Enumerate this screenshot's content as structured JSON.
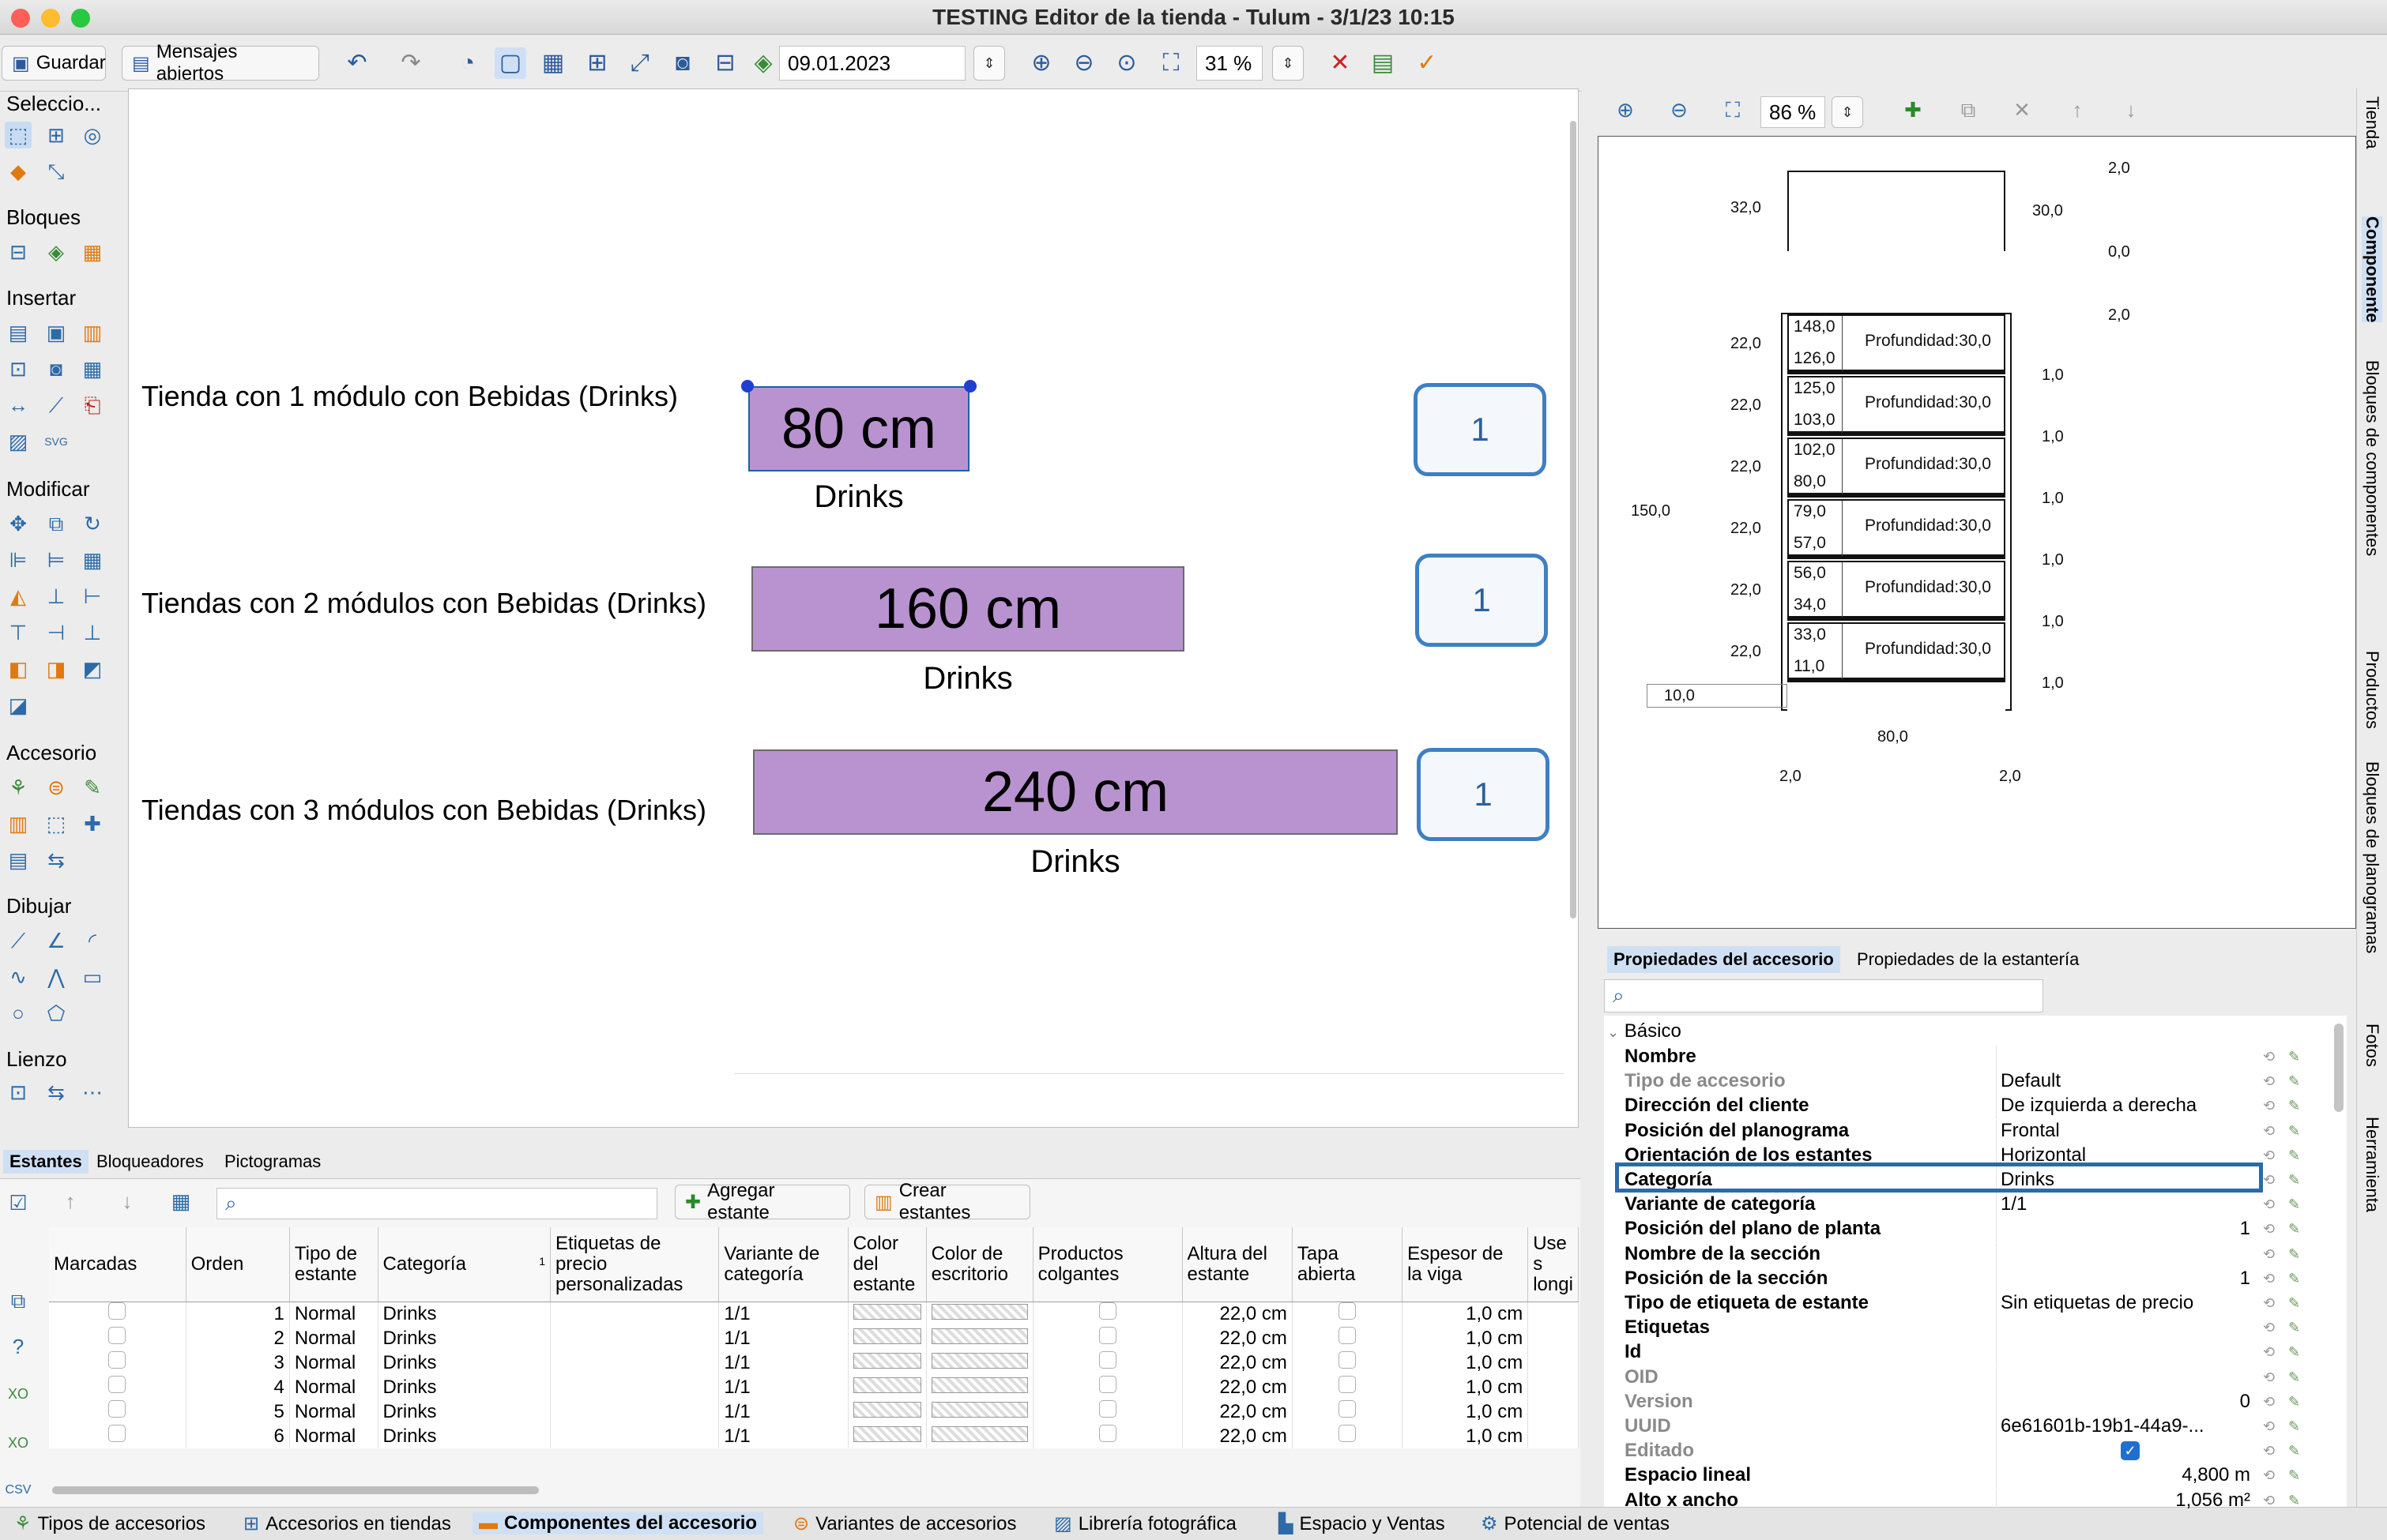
{
  "window": {
    "title": "TESTING Editor de la tienda - Tulum - 3/1/23 10:15"
  },
  "toolbar": {
    "save_label": "Guardar",
    "messages_label": "Mensajes abiertos",
    "date_value": "09.01.2023",
    "zoom_value": "31 %"
  },
  "palette": {
    "select": "Seleccio...",
    "blocks": "Bloques",
    "insert": "Insertar",
    "modify": "Modificar",
    "accessory": "Accesorio",
    "draw": "Dibujar",
    "canvas": "Lienzo"
  },
  "canvas": {
    "rows": [
      {
        "label": "Tienda con 1 módulo con Bebidas (Drinks)",
        "size": "80 cm",
        "category": "Drinks",
        "count": "1"
      },
      {
        "label": "Tiendas con 2 módulos con Bebidas (Drinks)",
        "size": "160 cm",
        "category": "Drinks",
        "count": "1"
      },
      {
        "label": "Tiendas con 3 módulos con Bebidas (Drinks)",
        "size": "240 cm",
        "category": "Drinks",
        "count": "1"
      }
    ]
  },
  "bottom": {
    "tabs": [
      "Estantes",
      "Bloqueadores",
      "Pictogramas"
    ],
    "add_shelf": "Agregar estante",
    "create_shelves": "Crear estantes",
    "sort_indicator": "1",
    "columns": [
      "Marcadas",
      "Orden",
      "Tipo de estante",
      "Categoría",
      "Etiquetas de precio personalizadas",
      "Variante de categoría",
      "Color del estante",
      "Color de escritorio",
      "Productos colgantes",
      "Altura del estante",
      "Tapa abierta",
      "Espesor de la viga",
      "Use s longi"
    ],
    "rows": [
      {
        "order": "1",
        "type": "Normal",
        "category": "Drinks",
        "variant": "1/1",
        "height": "22,0 cm",
        "beam": "1,0 cm"
      },
      {
        "order": "2",
        "type": "Normal",
        "category": "Drinks",
        "variant": "1/1",
        "height": "22,0 cm",
        "beam": "1,0 cm"
      },
      {
        "order": "3",
        "type": "Normal",
        "category": "Drinks",
        "variant": "1/1",
        "height": "22,0 cm",
        "beam": "1,0 cm"
      },
      {
        "order": "4",
        "type": "Normal",
        "category": "Drinks",
        "variant": "1/1",
        "height": "22,0 cm",
        "beam": "1,0 cm"
      },
      {
        "order": "5",
        "type": "Normal",
        "category": "Drinks",
        "variant": "1/1",
        "height": "22,0 cm",
        "beam": "1,0 cm"
      },
      {
        "order": "6",
        "type": "Normal",
        "category": "Drinks",
        "variant": "1/1",
        "height": "22,0 cm",
        "beam": "1,0 cm"
      }
    ]
  },
  "statusbar": {
    "tabs": [
      "Tipos de accesorios",
      "Accesorios en tiendas",
      "Componentes del accesorio",
      "Variantes de accesorios",
      "Librería fotográfica",
      "Espacio y Ventas",
      "Potencial de ventas"
    ]
  },
  "right": {
    "zoom_value": "86 %",
    "drawing": {
      "top_dims": [
        "32,0",
        "30,0",
        "2,0",
        "0,0",
        "2,0"
      ],
      "left_dims": [
        "22,0",
        "22,0",
        "22,0",
        "22,0",
        "22,0",
        "22,0"
      ],
      "right_dims": [
        "1,0",
        "1,0",
        "1,0",
        "1,0",
        "1,0",
        "1,0"
      ],
      "height_total": "150,0",
      "base": "10,0",
      "width": "80,0",
      "foot_left": "2,0",
      "foot_right": "2,0",
      "shelves": [
        {
          "top": "148,0",
          "bottom": "126,0",
          "depth": "Profundidad:30,0"
        },
        {
          "top": "125,0",
          "bottom": "103,0",
          "depth": "Profundidad:30,0"
        },
        {
          "top": "102,0",
          "bottom": "80,0",
          "depth": "Profundidad:30,0"
        },
        {
          "top": "79,0",
          "bottom": "57,0",
          "depth": "Profundidad:30,0"
        },
        {
          "top": "56,0",
          "bottom": "34,0",
          "depth": "Profundidad:30,0"
        },
        {
          "top": "33,0",
          "bottom": "11,0",
          "depth": "Profundidad:30,0"
        }
      ]
    },
    "prop_tabs": [
      "Propiedades del accesorio",
      "Propiedades de la estantería"
    ],
    "section": "Básico",
    "properties": [
      {
        "name": "Nombre",
        "value": "",
        "muted": false
      },
      {
        "name": "Tipo de accesorio",
        "value": "Default",
        "muted": true
      },
      {
        "name": "Dirección del cliente",
        "value": "De izquierda a derecha",
        "muted": false
      },
      {
        "name": "Posición del planograma",
        "value": "Frontal",
        "muted": false
      },
      {
        "name": "Orientación de los estantes",
        "value": "Horizontal",
        "muted": false
      },
      {
        "name": "Categoría",
        "value": "Drinks",
        "muted": false
      },
      {
        "name": "Variante de categoría",
        "value": "1/1",
        "muted": false
      },
      {
        "name": "Posición del plano de planta",
        "value": "1",
        "muted": false
      },
      {
        "name": "Nombre de la sección",
        "value": "",
        "muted": false
      },
      {
        "name": "Posición de la sección",
        "value": "1",
        "muted": false
      },
      {
        "name": "Tipo de etiqueta de estante",
        "value": "Sin etiquetas de precio",
        "muted": false
      },
      {
        "name": "Etiquetas",
        "value": "",
        "muted": false
      },
      {
        "name": "Id",
        "value": "",
        "muted": false
      },
      {
        "name": "OID",
        "value": "",
        "muted": true
      },
      {
        "name": "Version",
        "value": "0",
        "muted": true
      },
      {
        "name": "UUID",
        "value": "6e61601b-19b1-44a9-...",
        "muted": true
      },
      {
        "name": "Editado",
        "value": "",
        "muted": true
      },
      {
        "name": "Espacio lineal",
        "value": "4,800 m",
        "muted": false
      },
      {
        "name": "Alto x ancho",
        "value": "1,056 m²",
        "muted": false
      }
    ]
  },
  "vtabs": [
    "Tienda",
    "Componente",
    "Bloques de componentes",
    "Productos",
    "Bloques de planogramas",
    "Fotos",
    "Herramienta"
  ],
  "colors": {
    "accent": "#3f7fc4",
    "shelf_fill": "#b993d0",
    "selection": "#1f5fa8"
  }
}
